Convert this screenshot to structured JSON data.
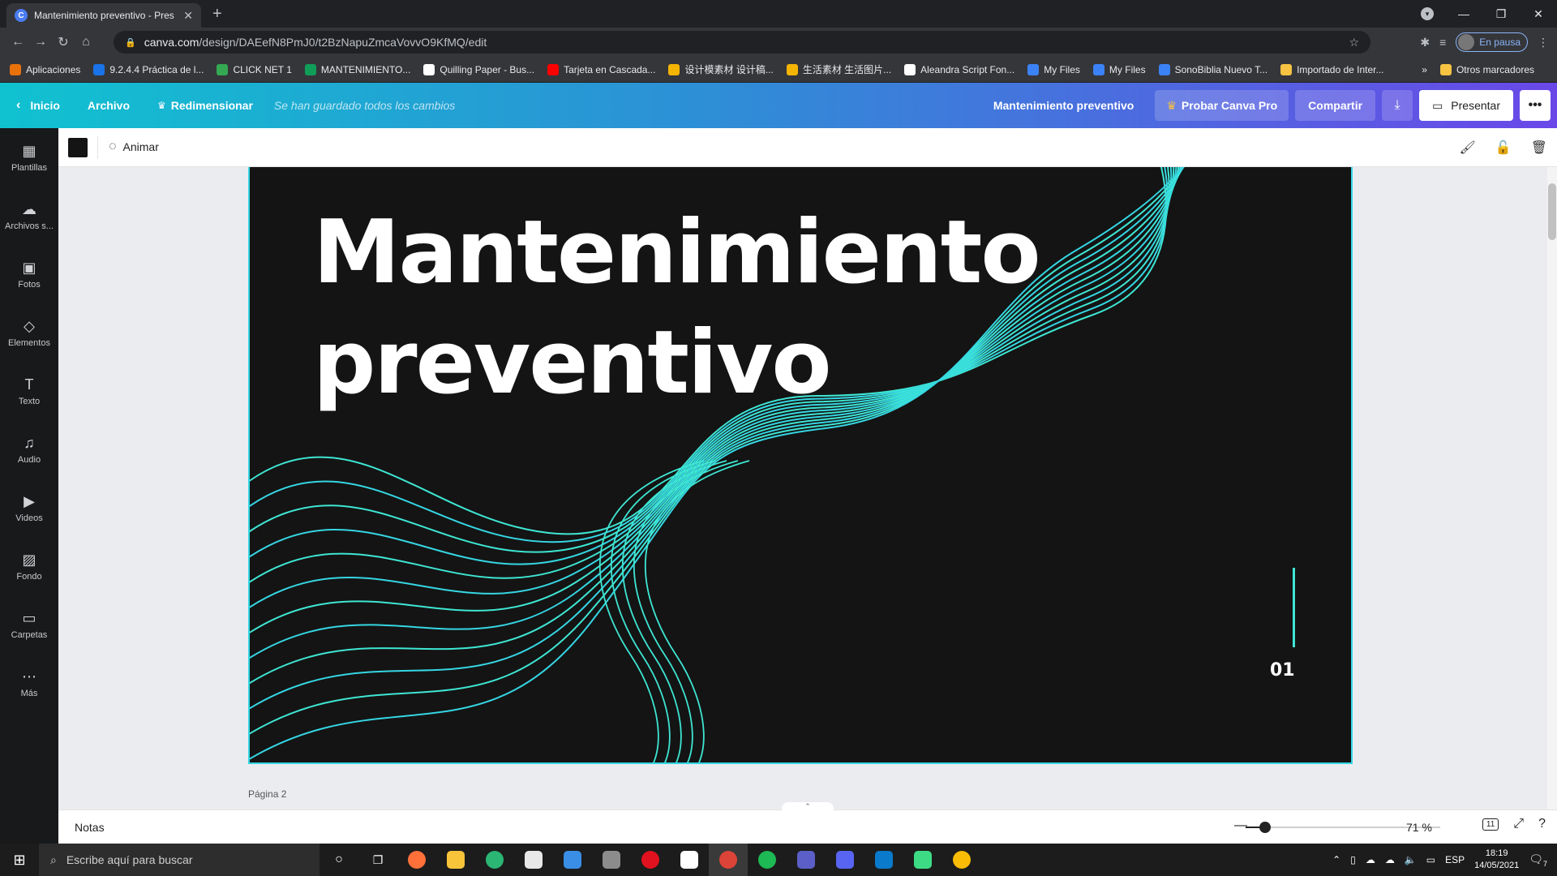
{
  "browser": {
    "tab_title": "Mantenimiento preventivo - Pres",
    "tab_favicon": "C",
    "url_domain": "canva.com",
    "url_path": "/design/DAEefN8PmJ0/t2BzNapuZmcaVovvO9KfMQ/edit",
    "profile_label": "En pausa"
  },
  "bookmarks": [
    {
      "label": "Aplicaciones",
      "color": "#e8710a"
    },
    {
      "label": "9.2.4.4 Práctica de l...",
      "color": "#1a73e8"
    },
    {
      "label": "CLICK NET 1",
      "color": "#34a853"
    },
    {
      "label": "MANTENIMIENTO...",
      "color": "#0f9d58"
    },
    {
      "label": "Quilling Paper - Bus...",
      "color": "#ffffff"
    },
    {
      "label": "Tarjeta en Cascada...",
      "color": "#ff0000"
    },
    {
      "label": "设计模素材 设计稿...",
      "color": "#f4b400"
    },
    {
      "label": "生活素材 生活图片...",
      "color": "#f4b400"
    },
    {
      "label": "Aleandra Script Fon...",
      "color": "#ffffff"
    },
    {
      "label": "My Files",
      "color": "#3b82f6"
    },
    {
      "label": "My Files",
      "color": "#3b82f6"
    },
    {
      "label": "SonoBiblia Nuevo T...",
      "color": "#3b82f6"
    },
    {
      "label": "Importado de Inter...",
      "color": "#f6c342"
    }
  ],
  "bookmarks_more": "»",
  "bookmarks_other": "Otros marcadores",
  "header": {
    "home": "Inicio",
    "file": "Archivo",
    "resize": "Redimensionar",
    "saved_status": "Se han guardado todos los cambios",
    "doc_title": "Mantenimiento preventivo",
    "try_pro": "Probar Canva Pro",
    "share": "Compartir",
    "present": "Presentar"
  },
  "sidebar": [
    {
      "label": "Plantillas",
      "icon": "templates-icon",
      "glyph": "▦"
    },
    {
      "label": "Archivos s...",
      "icon": "upload-cloud-icon",
      "glyph": "☁"
    },
    {
      "label": "Fotos",
      "icon": "photo-icon",
      "glyph": "▣"
    },
    {
      "label": "Elementos",
      "icon": "elements-icon",
      "glyph": "◇"
    },
    {
      "label": "Texto",
      "icon": "text-icon",
      "glyph": "T"
    },
    {
      "label": "Audio",
      "icon": "music-note-icon",
      "glyph": "♫"
    },
    {
      "label": "Videos",
      "icon": "video-icon",
      "glyph": "▶"
    },
    {
      "label": "Fondo",
      "icon": "background-pattern-icon",
      "glyph": "▨"
    },
    {
      "label": "Carpetas",
      "icon": "folder-icon",
      "glyph": "▭"
    },
    {
      "label": "Más",
      "icon": "more-dots-icon",
      "glyph": "⋯"
    }
  ],
  "context": {
    "animate": "Animar",
    "swatch_color": "#141414"
  },
  "slide": {
    "title_line1": "Mantenimiento",
    "title_line2": "preventivo",
    "number": "01",
    "accent": "#35d6e3"
  },
  "next_page_label": "Página 2",
  "notes": {
    "label": "Notas",
    "zoom_value": "71 %",
    "zoom_fraction": 0.1,
    "page_count": "11"
  },
  "taskbar": {
    "search_placeholder": "Escribe aquí para buscar",
    "lang": "ESP",
    "time": "18:19",
    "date": "14/05/2021",
    "notifications": "7"
  }
}
